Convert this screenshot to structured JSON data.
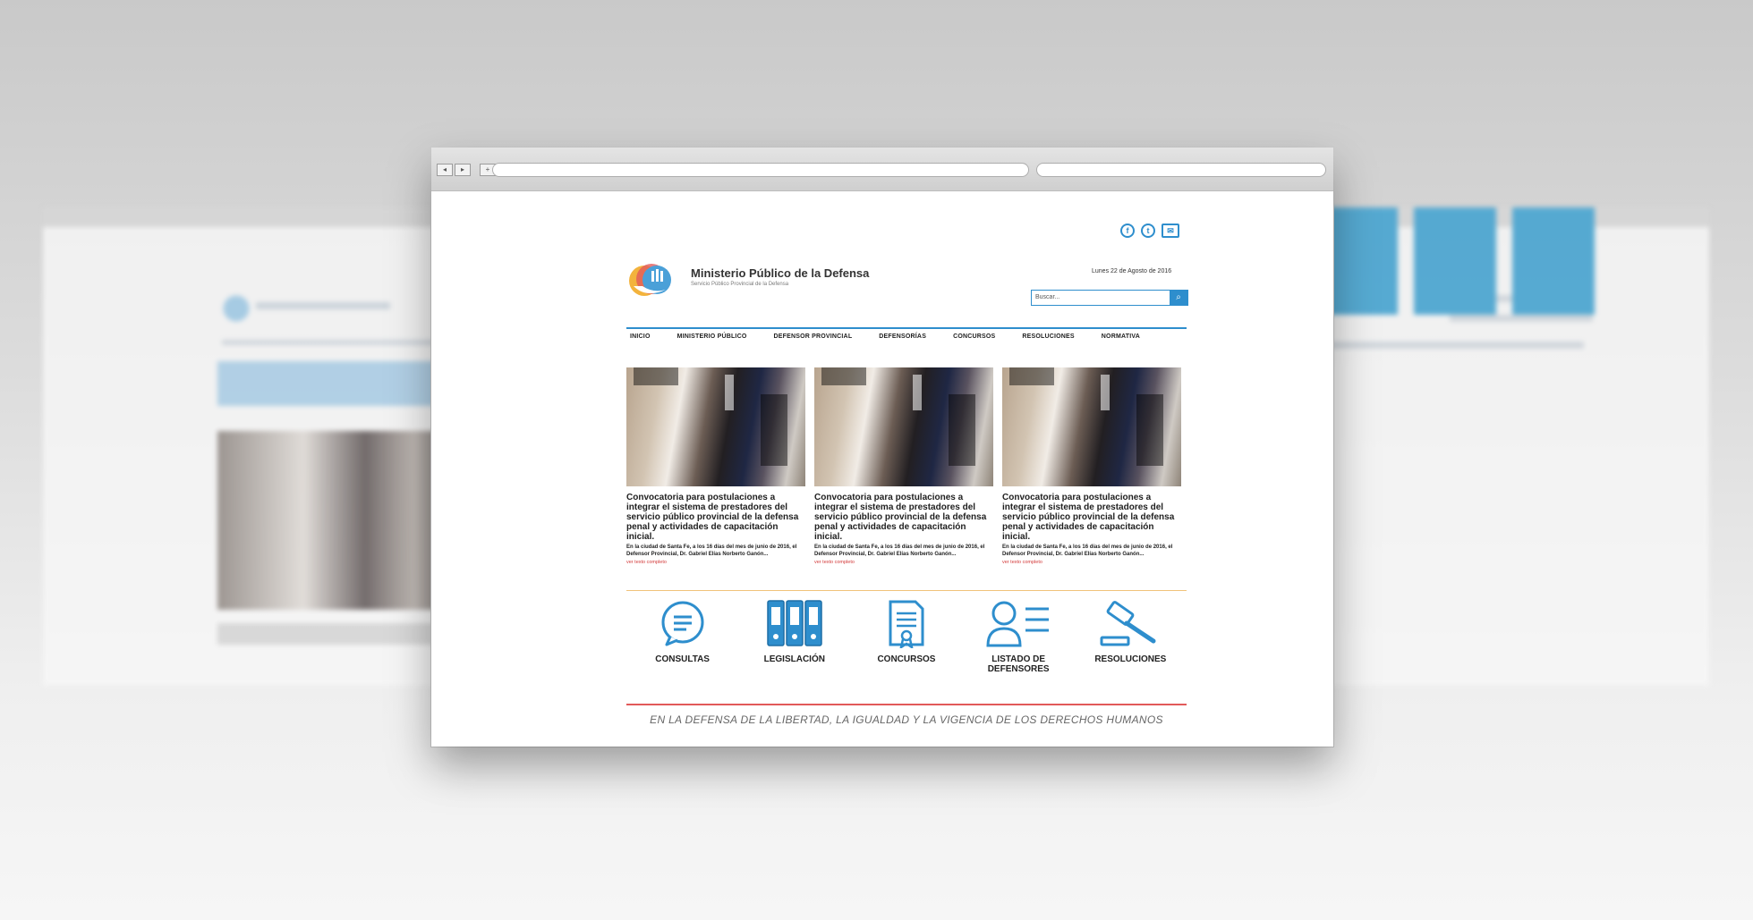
{
  "browser": {
    "back": "◂",
    "forward": "▸",
    "new_tab": "+"
  },
  "site": {
    "brand_title": "Ministerio Público de la Defensa",
    "brand_subtitle": "Servicio Público Provincial de la Defensa",
    "date": "Lunes 22 de Agosto de 2016",
    "search_placeholder": "Buscar...",
    "search_button": "⌕",
    "social": {
      "facebook": "f",
      "twitter": "t"
    },
    "menu": [
      "INICIO",
      "MINISTERIO PÚBLICO",
      "DEFENSOR PROVINCIAL",
      "DEFENSORÍAS",
      "CONCURSOS",
      "RESOLUCIONES",
      "NORMATIVA"
    ],
    "news": [
      {
        "title": "Convocatoria para postulaciones a integrar el sistema de prestadores del servicio público provincial de la defensa penal y actividades de capacitación inicial.",
        "text": "En la ciudad de Santa Fe, a los 16 días del mes de junio de 2016, el Defensor Provincial, Dr. Gabriel Elías Norberto Ganón...",
        "more": "ver texto completo"
      },
      {
        "title": "Convocatoria para postulaciones a integrar el sistema de prestadores del servicio público provincial de la defensa penal y actividades de capacitación inicial.",
        "text": "En la ciudad de Santa Fe, a los 16 días del mes de junio de 2016, el Defensor Provincial, Dr. Gabriel Elías Norberto Ganón...",
        "more": "ver texto completo"
      },
      {
        "title": "Convocatoria para postulaciones a integrar el sistema de prestadores del servicio público provincial de la defensa penal y actividades de capacitación inicial.",
        "text": "En la ciudad de Santa Fe, a los 16 días del mes de junio de 2016, el Defensor Provincial, Dr. Gabriel Elías Norberto Ganón...",
        "more": "ver texto completo"
      }
    ],
    "icons": [
      "CONSULTAS",
      "LEGISLACIÓN",
      "CONCURSOS",
      "LISTADO DE DEFENSORES",
      "RESOLUCIONES"
    ],
    "slogan": "EN LA DEFENSA DE LA LIBERTAD, LA IGUALDAD Y LA VIGENCIA DE LOS DERECHOS HUMANOS"
  },
  "colors": {
    "accent": "#2e8ecd",
    "rule_top": "#f0c37a",
    "rule_bottom": "#e25a5a",
    "more_link": "#d33a3a"
  }
}
